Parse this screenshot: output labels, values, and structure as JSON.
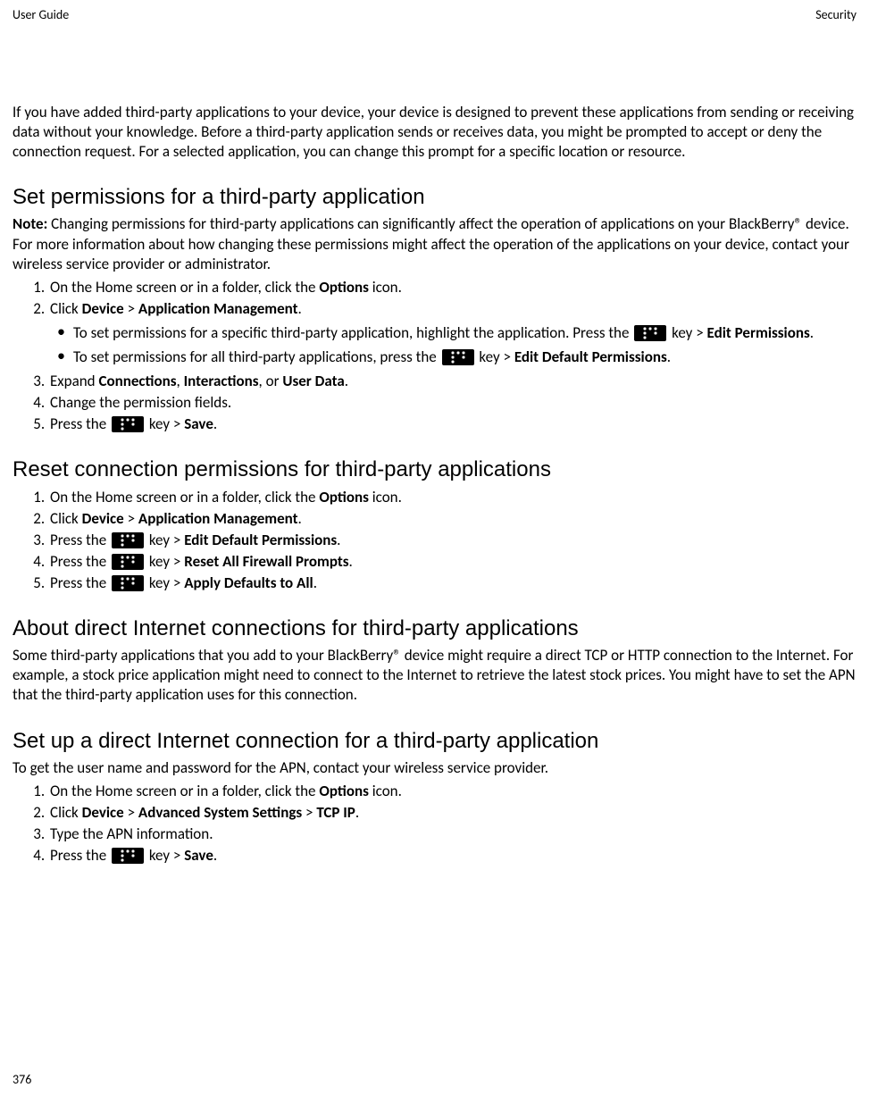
{
  "header": {
    "left": "User Guide",
    "right": "Security"
  },
  "intro": "If you have added third-party applications to your device, your device is designed to prevent these applications from sending or receiving data without your knowledge. Before a third-party application sends or receives data, you might be prompted to accept or deny the connection request. For a selected application, you can change this prompt for a specific location or resource.",
  "section1": {
    "title": "Set permissions for a third-party application",
    "note_label": "Note:",
    "note_text": " Changing permissions for third-party applications can significantly affect the operation of applications on your BlackBerry® device. For more information about how changing these permissions might affect the operation of the applications on your device, contact your wireless service provider or administrator.",
    "step1_a": "On the Home screen or in a folder, click the ",
    "step1_b": "Options",
    "step1_c": " icon.",
    "step2_a": "Click ",
    "step2_b": "Device",
    "step2_c": " > ",
    "step2_d": "Application Management",
    "step2_e": ".",
    "bullet1_a": "To set permissions for a specific third-party application, highlight the application. Press the ",
    "bullet1_b": " key > ",
    "bullet1_c": "Edit Permissions",
    "bullet1_d": ".",
    "bullet2_a": "To set permissions for all third-party applications, press the ",
    "bullet2_b": " key > ",
    "bullet2_c": "Edit Default Permissions",
    "bullet2_d": ".",
    "step3_a": "Expand ",
    "step3_b": "Connections",
    "step3_c": ", ",
    "step3_d": "Interactions",
    "step3_e": ", or ",
    "step3_f": "User Data",
    "step3_g": ".",
    "step4": "Change the permission fields.",
    "step5_a": "Press the ",
    "step5_b": " key > ",
    "step5_c": "Save",
    "step5_d": "."
  },
  "section2": {
    "title": "Reset connection permissions for third-party applications",
    "step1_a": "On the Home screen or in a folder, click the ",
    "step1_b": "Options",
    "step1_c": " icon.",
    "step2_a": "Click ",
    "step2_b": "Device",
    "step2_c": " > ",
    "step2_d": "Application Management",
    "step2_e": ".",
    "step3_a": "Press the ",
    "step3_b": " key > ",
    "step3_c": "Edit Default Permissions",
    "step3_d": ".",
    "step4_a": "Press the ",
    "step4_b": " key > ",
    "step4_c": "Reset All Firewall Prompts",
    "step4_d": ".",
    "step5_a": "Press the ",
    "step5_b": " key > ",
    "step5_c": "Apply Defaults to All",
    "step5_d": "."
  },
  "section3": {
    "title": "About direct Internet connections for third-party applications",
    "text": "Some third-party applications that you add to your BlackBerry® device might require a direct TCP or HTTP connection to the Internet. For example, a stock price application might need to connect to the Internet to retrieve the latest stock prices. You might have to set the APN that the third-party application uses for this connection."
  },
  "section4": {
    "title": "Set up a direct Internet connection for a third-party application",
    "intro": "To get the user name and password for the APN, contact your wireless service provider.",
    "step1_a": "On the Home screen or in a folder, click the ",
    "step1_b": "Options",
    "step1_c": " icon.",
    "step2_a": "Click ",
    "step2_b": "Device",
    "step2_c": " > ",
    "step2_d": "Advanced System Settings",
    "step2_e": " > ",
    "step2_f": "TCP IP",
    "step2_g": ".",
    "step3": "Type the APN information.",
    "step4_a": "Press the ",
    "step4_b": " key > ",
    "step4_c": "Save",
    "step4_d": "."
  },
  "page_number": "376"
}
